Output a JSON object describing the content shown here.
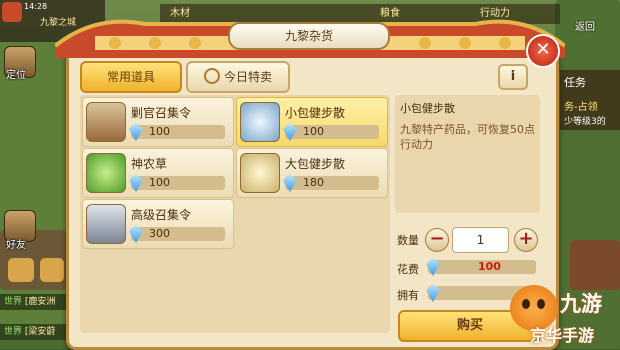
{
  "hud": {
    "time": "14:28",
    "city": "九黎之城",
    "locate_label": "定位",
    "friends_label": "好友",
    "chat_lines": [
      {
        "channel": "世界",
        "text": "[鹿安洲"
      },
      {
        "channel": "世界",
        "text": "[梁安蔚"
      }
    ],
    "top_strip": [
      "木材",
      "粮食",
      "行动力"
    ],
    "right": {
      "return_label": "返回",
      "task_label": "任务",
      "task_line1": "务-占领",
      "task_line2": "少等级3的"
    }
  },
  "window": {
    "title": "九黎杂货",
    "close_glyph": "✕",
    "info_glyph": "i",
    "tabs": [
      {
        "label": "常用道具",
        "active": true
      },
      {
        "label": "今日特卖",
        "active": false
      }
    ]
  },
  "items": [
    {
      "name": "剿官召集令",
      "price": "100",
      "icon": "scroll-icon",
      "selected": false
    },
    {
      "name": "小包健步散",
      "price": "100",
      "icon": "bowl-icon",
      "selected": true
    },
    {
      "name": "神农草",
      "price": "100",
      "icon": "herb-icon",
      "selected": false
    },
    {
      "name": "大包健步散",
      "price": "180",
      "icon": "bowl-icon",
      "selected": false
    },
    {
      "name": "高级召集令",
      "price": "300",
      "icon": "scroll-icon",
      "selected": false
    }
  ],
  "detail": {
    "name": "小包健步散",
    "description": "九黎特产药品，可恢复50点行动力"
  },
  "purchase": {
    "qty_label": "数量",
    "qty_value": "1",
    "minus_glyph": "−",
    "plus_glyph": "+",
    "cost_label": "花费",
    "cost_value": "100",
    "own_label": "拥有",
    "buy_label": "购买"
  },
  "watermark": {
    "brand": "九游",
    "sub": "京华手游"
  },
  "colors": {
    "accent_gold": "#f0b22c",
    "selected_item": "#f7d96a",
    "close_red": "#b81d10",
    "cost_red": "#d01a10",
    "gem_blue": "#3e9be0"
  }
}
